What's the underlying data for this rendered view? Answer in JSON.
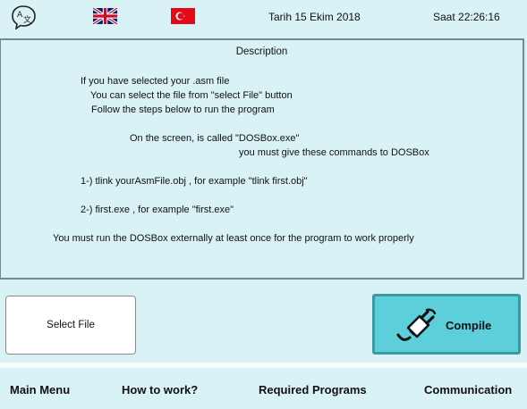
{
  "header": {
    "date_text": "Tarih 15 Ekim 2018",
    "time_text": "Saat 22:26:16",
    "language_icon": "translate-icon",
    "flags": [
      "uk-flag",
      "turkey-flag"
    ]
  },
  "description": {
    "title": "Description",
    "lines": [
      "If you have selected your .asm file",
      "You can select the file from \"select File\" button",
      "Follow the steps below to run the program",
      "On the screen, is called \"DOSBox.exe\"",
      "you must give these commands to DOSBox",
      "1-)  tlink yourAsmFile.obj , for example \"tlink first.obj\"",
      "2-)  first.exe , for example \"first.exe\"",
      "You must run the DOSBox externally at least once for the program to work properly"
    ]
  },
  "buttons": {
    "select_file": "Select File",
    "compile": "Compile",
    "compile_icon": "plug-icon"
  },
  "nav": {
    "main_menu": "Main Menu",
    "how_to_work": "How to work?",
    "required_programs": "Required Programs",
    "communication": "Communication"
  },
  "colors": {
    "background": "#d9f2f5",
    "compile_fill": "#5ccfdb",
    "compile_border": "#3a9aa4",
    "panel_border": "#6f8e94"
  }
}
